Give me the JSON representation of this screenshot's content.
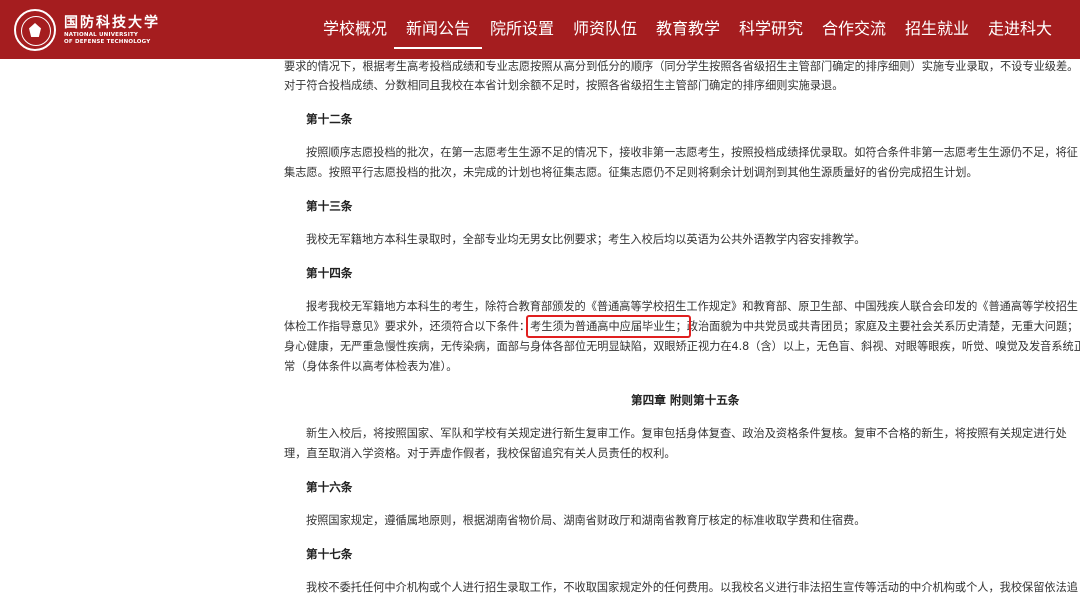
{
  "header": {
    "logo_cn": "国防科技大学",
    "logo_en_1": "NATIONAL UNIVERSITY",
    "logo_en_2": "OF DEFENSE TECHNOLOGY",
    "nav": [
      {
        "label": "学校概况",
        "active": false
      },
      {
        "label": "新闻公告",
        "active": true
      },
      {
        "label": "院所设置",
        "active": false
      },
      {
        "label": "师资队伍",
        "active": false
      },
      {
        "label": "教育教学",
        "active": false
      },
      {
        "label": "科学研究",
        "active": false
      },
      {
        "label": "合作交流",
        "active": false
      },
      {
        "label": "招生就业",
        "active": false
      },
      {
        "label": "走进科大",
        "active": false
      }
    ],
    "colors": {
      "bar": "#a51d1f",
      "text": "#ffffff"
    }
  },
  "article": {
    "p11_l1": "要求的情况下，根据考生高考投档成绩和专业志愿按照从高分到低分的顺序（同分学生按照各省级招生主管部门确定的排序细则）实施专业录取，不设专业级差。",
    "p11_l2": "对于符合投档成绩、分数相同且我校在本省计划余额不足时，按照各省级招生主管部门确定的排序细则实施录退。",
    "h12": "第十二条",
    "p12_l1": "按照顺序志愿投档的批次，在第一志愿考生生源不足的情况下，接收非第一志愿考生，按照投档成绩择优录取。如符合条件非第一志愿考生生源仍不足，将征",
    "p12_l2": "集志愿。按照平行志愿投档的批次，未完成的计划也将征集志愿。征集志愿仍不足则将剩余计划调剂到其他生源质量好的省份完成招生计划。",
    "h13": "第十三条",
    "p13_l1": "我校无军籍地方本科生录取时，全部专业均无男女比例要求；考生入校后均以英语为公共外语教学内容安排教学。",
    "h14": "第十四条",
    "p14_l1": "报考我校无军籍地方本科生的考生，除符合教育部颁发的《普通高等学校招生工作规定》和教育部、原卫生部、中国残疾人联合会印发的《普通高等学校招生",
    "p14_l2a": "体检工作指导意见》要求外，还须符合以下条件：",
    "p14_l2_highlight": "考生须为普通高中应届毕业生；",
    "p14_l2b": "政治面貌为中共党员或共青团员；家庭及主要社会关系历史清楚，无重大问题；",
    "p14_l3": "身心健康，无严重急慢性疾病，无传染病，面部与身体各部位无明显缺陷，双眼矫正视力在4.8（含）以上，无色盲、斜视、对眼等眼疾，听觉、嗅觉及发音系统正",
    "p14_l4": "常（身体条件以高考体检表为准）。",
    "chapter4": "第四章 附则第十五条",
    "p15_l1": "新生入校后，将按照国家、军队和学校有关规定进行新生复审工作。复审包括身体复查、政治及资格条件复核。复审不合格的新生，将按照有关规定进行处",
    "p15_l2": "理，直至取消入学资格。对于弄虚作假者，我校保留追究有关人员责任的权利。",
    "h16": "第十六条",
    "p16_l1": "按照国家规定，遵循属地原则，根据湖南省物价局、湖南省财政厅和湖南省教育厅核定的标准收取学费和住宿费。",
    "h17": "第十七条",
    "p17_l1": "我校不委托任何中介机构或个人进行招生录取工作，不收取国家规定外的任何费用。以我校名义进行非法招生宣传等活动的中介机构或个人，我校保留依法追",
    "highlight_color": "#e02020"
  }
}
